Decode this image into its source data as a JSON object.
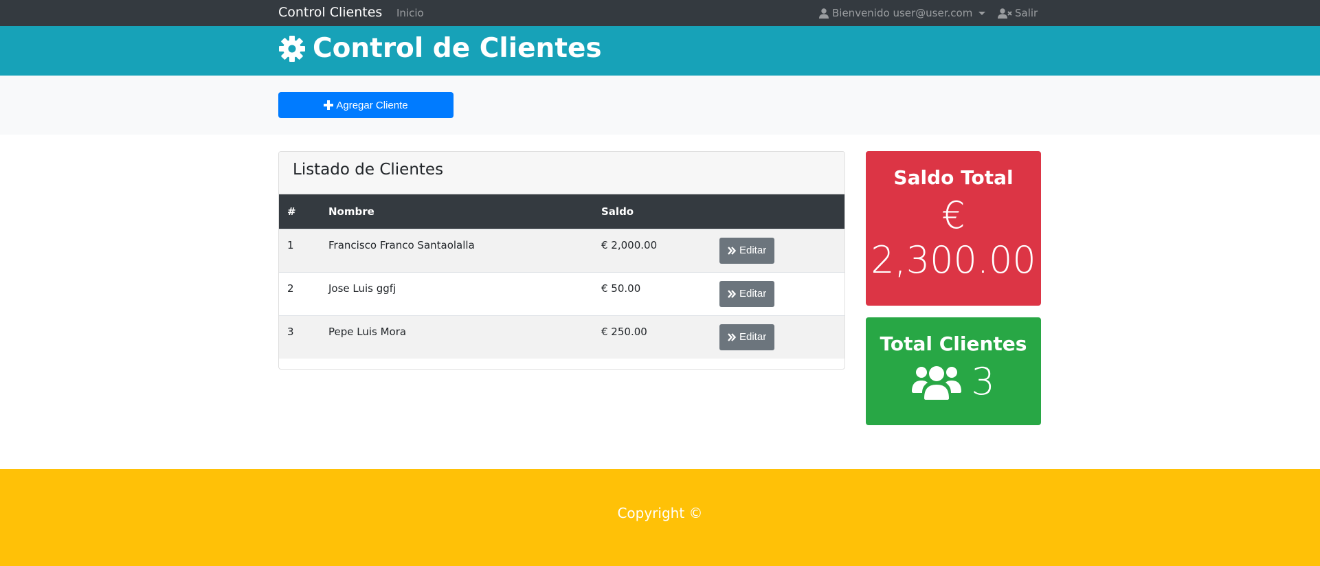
{
  "navbar": {
    "brand": "Control Clientes",
    "link_inicio": "Inicio",
    "user_label": "Bienvenido user@user.com",
    "logout_label": "Salir"
  },
  "header": {
    "title": "Control de Clientes"
  },
  "actions": {
    "add_label": "Agregar Cliente"
  },
  "listado": {
    "title": "Listado de Clientes",
    "columns": [
      "#",
      "Nombre",
      "Saldo",
      ""
    ],
    "rows": [
      {
        "num": "1",
        "nombre": "Francisco Franco Santaolalla",
        "saldo": "€ 2,000.00",
        "action": "Editar"
      },
      {
        "num": "2",
        "nombre": "Jose Luis ggfj",
        "saldo": "€ 50.00",
        "action": "Editar"
      },
      {
        "num": "3",
        "nombre": "Pepe Luis Mora",
        "saldo": "€ 250.00",
        "action": "Editar"
      }
    ]
  },
  "saldo_total": {
    "title": "Saldo Total",
    "currency": "€",
    "amount": "2,300.00"
  },
  "total_clientes": {
    "title": "Total Clientes",
    "count": "3"
  },
  "footer": {
    "copyright": "Copyright ©"
  },
  "colors": {
    "navbar": "#343a40",
    "header": "#17a2b8",
    "primary": "#007bff",
    "danger": "#dc3545",
    "success": "#28a745",
    "warning": "#ffc107",
    "secondary": "#6c757d"
  }
}
